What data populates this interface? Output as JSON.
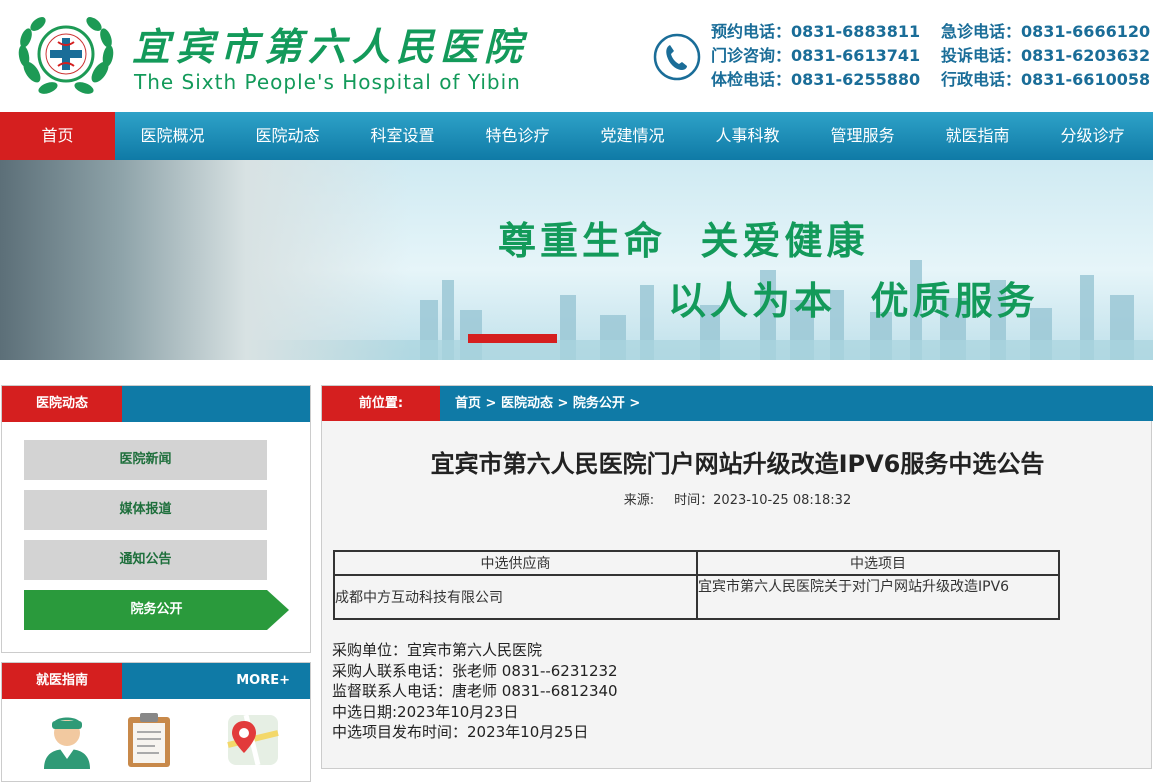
{
  "header": {
    "hospital_name_cn": "宜宾市第六人民医院",
    "hospital_name_en": "The Sixth People's Hospital of Yibin",
    "contacts": [
      [
        "预约电话：0831-6883811",
        "急诊电话：0831-6666120"
      ],
      [
        "门诊咨询：0831-6613741",
        "投诉电话：0831-6203632"
      ],
      [
        "体检电话：0831-6255880",
        "行政电话：0831-6610058"
      ]
    ]
  },
  "nav": {
    "items": [
      "首页",
      "医院概况",
      "医院动态",
      "科室设置",
      "特色诊疗",
      "党建情况",
      "人事科教",
      "管理服务",
      "就医指南",
      "分级诊疗"
    ]
  },
  "banner": {
    "slogan_line1": "尊重生命  关爱健康",
    "slogan_line2": "以人为本  优质服务"
  },
  "sidebar": {
    "news_title": "医院动态",
    "news_items": [
      "医院新闻",
      "媒体报道",
      "通知公告",
      "院务公开"
    ],
    "guide_title": "就医指南",
    "guide_more": "MORE+"
  },
  "main": {
    "location_label": "前位置:",
    "breadcrumb": [
      "首页 >",
      "医院动态 >",
      "院务公开 >"
    ],
    "title": "宜宾市第六人民医院门户网站升级改造IPV6服务中选公告",
    "source_label": "来源:",
    "time_label": "时间：2023-10-25 08:18:32",
    "table": {
      "headers": [
        "中选供应商",
        "中选项目"
      ],
      "row": [
        "成都中方互动科技有限公司",
        "宜宾市第六人民医院关于对门户网站升级改造IPV6"
      ]
    },
    "info_lines": [
      "采购单位：宜宾市第六人民医院",
      "采购人联系电话：张老师 0831--6231232",
      "监督联系人电话：唐老师 0831--6812340",
      "中选日期:2023年10月23日",
      "中选项目发布时间：2023年10月25日"
    ]
  },
  "colors": {
    "brand_green": "#139a5a",
    "nav_blue": "#0f7aa6",
    "accent_red": "#d51f1f",
    "menu_active_green": "#2a9a3c"
  }
}
